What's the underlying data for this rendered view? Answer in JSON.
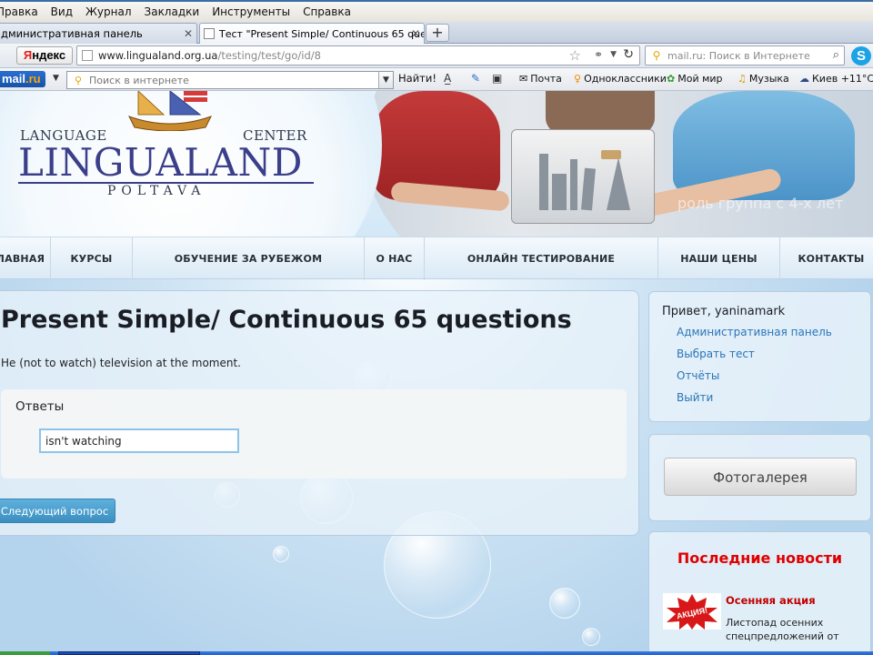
{
  "menubar": {
    "items": [
      "Правка",
      "Вид",
      "Журнал",
      "Закладки",
      "Инструменты",
      "Справка"
    ]
  },
  "tabs": [
    {
      "label": "дминистративная панель",
      "active": false
    },
    {
      "label": "Тест \"Present Simple/ Continuous 65 que...",
      "active": true
    }
  ],
  "navbar": {
    "yandex_label_red": "Я",
    "yandex_label_rest": "ндекс",
    "url_domain": "www.lingualand.org.ua",
    "url_path": "/testing/test/go/id/8",
    "search_placeholder": "mail.ru: Поиск в Интернете"
  },
  "mailbar": {
    "logo_main": "mail",
    "logo_suffix": ".ru",
    "search_placeholder": "Поиск в интернете",
    "find_label": "Найти!",
    "links": {
      "mail": "Почта",
      "classmates": "Одноклассники",
      "myworld": "Мой мир",
      "music": "Музыка",
      "weather": "Киев +11°С"
    }
  },
  "site": {
    "logo": {
      "language": "LANGUAGE",
      "center": "CENTER",
      "name": "LINGUALAND",
      "city": "POLTAVA"
    },
    "slogan": "роль группа с 4-х лет",
    "nav": [
      "ЛАВНАЯ",
      "КУРСЫ",
      "ОБУЧЕНИЕ ЗА РУБЕЖОМ",
      "О НАС",
      "ОНЛАЙН ТЕСТИРОВАНИЕ",
      "НАШИ ЦЕНЫ",
      "КОНТАКТЫ"
    ]
  },
  "test": {
    "title": "Present Simple/ Continuous 65 questions",
    "question": "He (not to watch) television at the moment.",
    "answers_label": "Ответы",
    "answer_value": "isn't watching",
    "next_button": "Следующий вопрос"
  },
  "sidebar": {
    "greeting": "Привет, yaninamark",
    "links": [
      "Административная панель",
      "Выбрать тест",
      "Отчёты",
      "Выйти"
    ],
    "gallery_button": "Фотогалерея",
    "news_title": "Последние новости",
    "news_badge": "АКЦИЯ!",
    "news_item_title": "Осенняя акция",
    "news_item_line1": "Листопад осенних",
    "news_item_line2": "спецпредложений от"
  },
  "colors": {
    "accent": "#2a75b8",
    "news_red": "#e00000",
    "button_blue": "#3b8fc0"
  }
}
